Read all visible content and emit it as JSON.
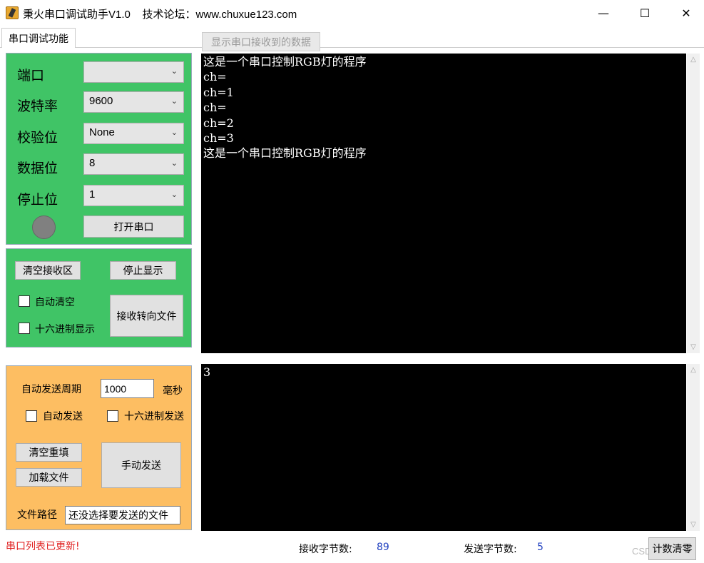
{
  "window": {
    "title": "秉火串口调试助手V1.0    技术论坛：www.chuxue123.com",
    "minimize": "—",
    "maximize": "☐",
    "close": "✕"
  },
  "tabs": {
    "active": "串口调试功能",
    "receive_display": "显示串口接收到的数据"
  },
  "serial": {
    "port_label": "端口",
    "port_value": "",
    "baud_label": "波特率",
    "baud_value": "9600",
    "parity_label": "校验位",
    "parity_value": "None",
    "databits_label": "数据位",
    "databits_value": "8",
    "stopbits_label": "停止位",
    "stopbits_value": "1",
    "open_button": "打开串口"
  },
  "receive_ctrl": {
    "clear_button": "清空接收区",
    "stop_display_button": "停止显示",
    "auto_clear_label": "自动清空",
    "hex_display_label": "十六进制显示",
    "to_file_button": "接收转向文件"
  },
  "send_ctrl": {
    "period_label": "自动发送周期",
    "period_value": "1000",
    "period_unit": "毫秒",
    "auto_send_label": "自动发送",
    "hex_send_label": "十六进制发送",
    "clear_refill_button": "清空重填",
    "load_file_button": "加载文件",
    "manual_send_button": "手动发送",
    "file_path_label": "文件路径",
    "file_path_value": "还没选择要发送的文件"
  },
  "receive_area": {
    "lines": [
      "这是一个串口控制RGB灯的程序",
      "ch=",
      "ch=1",
      "ch=",
      "ch=2",
      "ch=3",
      "这是一个串口控制RGB灯的程序"
    ]
  },
  "send_area": {
    "text": "3"
  },
  "status_bar": {
    "message": "串口列表已更新!",
    "message_color": "#e02020",
    "rx_label": "接收字节数:",
    "rx_value": "89",
    "tx_label": "发送字节数:",
    "tx_value": "5",
    "reset_button": "计数清零",
    "watermark": "CSDN"
  },
  "colors": {
    "serial_panel": "#40c466",
    "send_panel": "#fdbe62",
    "console_bg": "#000000",
    "count_value": "#2040c0"
  },
  "icons": {
    "chevron": "chevron-down-icon",
    "scroll_up": "scroll-up-icon",
    "scroll_down": "scroll-down-icon"
  }
}
